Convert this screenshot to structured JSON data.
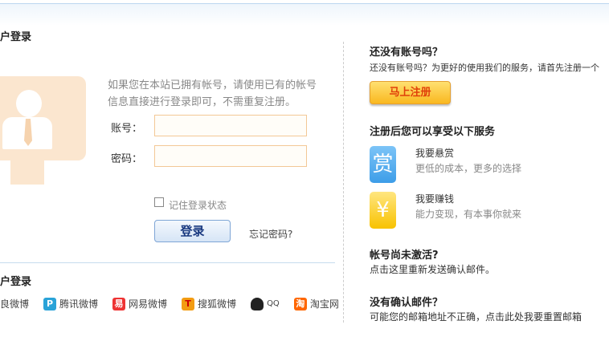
{
  "login": {
    "title": "户登录",
    "description": "如果您在本站已拥有帐号，请使用已有的帐号信息直接进行登录即可，不需重复注册。",
    "account_label": "账号：",
    "password_label": "密码：",
    "account_value": "",
    "password_value": "",
    "remember_label": "记住登录状态",
    "login_button": "登录",
    "forgot_link": "忘记密码?"
  },
  "third_party": {
    "title": "户登录",
    "items": [
      {
        "label": "良微博",
        "icon": "sina-weibo-icon"
      },
      {
        "label": "腾讯微博",
        "icon": "tencent-weibo-icon",
        "color": "#2aa3d8"
      },
      {
        "label": "网易微博",
        "icon": "netease-weibo-icon",
        "color": "#e33"
      },
      {
        "label": "搜狐微博",
        "icon": "sohu-weibo-icon",
        "color": "#f39c12"
      },
      {
        "label": "QQ",
        "icon": "qq-penguin-icon"
      },
      {
        "label": "淘宝网",
        "icon": "taobao-icon",
        "color": "#f60"
      }
    ]
  },
  "register": {
    "title": "还没有账号吗？",
    "text": "还没有账号吗？为更好的使用我们的服务，请首先注册一个",
    "button": "马上注册"
  },
  "services": {
    "title": "注册后您可以享受以下服务",
    "items": [
      {
        "glyph": "赏",
        "name": "我要悬赏",
        "desc": "更低的成本，更多的选择",
        "color": "#3d9de8"
      },
      {
        "glyph": "¥",
        "name": "我要赚钱",
        "desc": "能力变现，有本事你就来",
        "color": "#f8c200"
      }
    ]
  },
  "activate": {
    "title": "帐号尚未激活?",
    "text": "点击这里重新发送确认邮件。"
  },
  "no_email": {
    "title": "没有确认邮件？",
    "text": "可能您的邮箱地址不正确，点击此处我要重置邮箱"
  }
}
